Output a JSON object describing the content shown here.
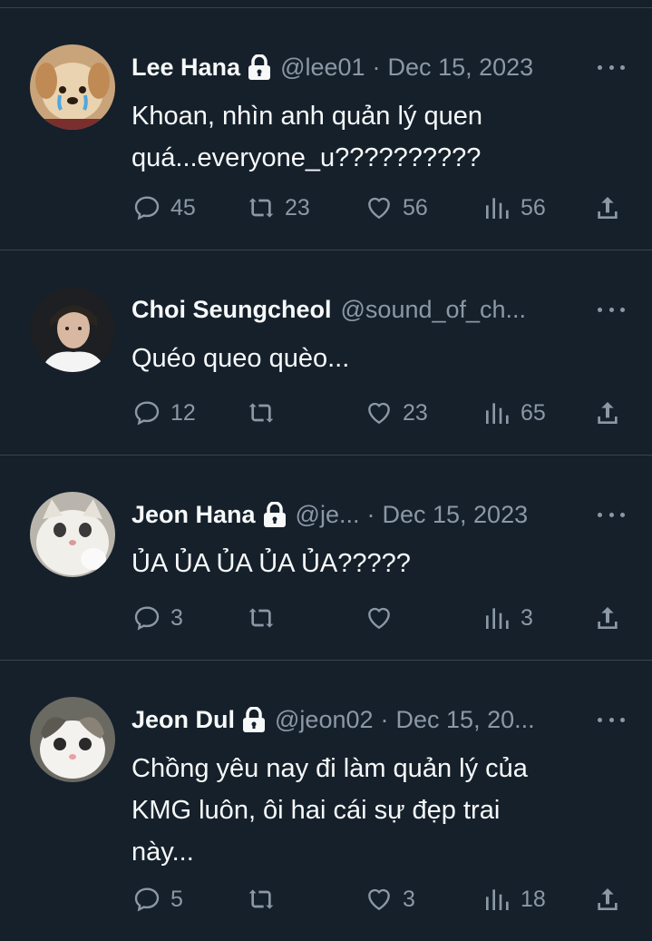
{
  "colors": {
    "background": "#15202b",
    "divider": "#38444d",
    "text": "#f7f9f9",
    "muted": "#8b98a5"
  },
  "tweets": [
    {
      "name": "Lee Hana",
      "locked": true,
      "handle": "@lee01",
      "separator": "·",
      "date": "Dec 15, 2023",
      "text": "Khoan, nhìn anh quản lý quen\nquá...everyone_u??????????",
      "replies": "45",
      "retweets": "23",
      "likes": "56",
      "views": "56",
      "avatar": "puppy-crying-avatar"
    },
    {
      "name": "Choi Seungcheol",
      "locked": false,
      "handle": "@sound_of_ch...",
      "separator": "",
      "date": "",
      "text": "Quéo queo quèo...",
      "replies": "12",
      "retweets": "",
      "likes": "23",
      "views": "65",
      "avatar": "man-portrait-avatar"
    },
    {
      "name": "Jeon Hana",
      "locked": true,
      "handle": "@je...",
      "separator": "·",
      "date": "Dec 15, 2023",
      "text": "ỦA ỦA ỦA ỦA ỦA?????",
      "replies": "3",
      "retweets": "",
      "likes": "",
      "views": "3",
      "avatar": "white-cat-avatar"
    },
    {
      "name": "Jeon Dul",
      "locked": true,
      "handle": "@jeon02",
      "separator": "·",
      "date": "Dec 15, 20...",
      "text": "Chồng yêu nay đi làm quản lý của\nKMG luôn, ôi hai cái sự đẹp trai\nnày...",
      "replies": "5",
      "retweets": "",
      "likes": "3",
      "views": "18",
      "avatar": "kitten-avatar"
    }
  ]
}
